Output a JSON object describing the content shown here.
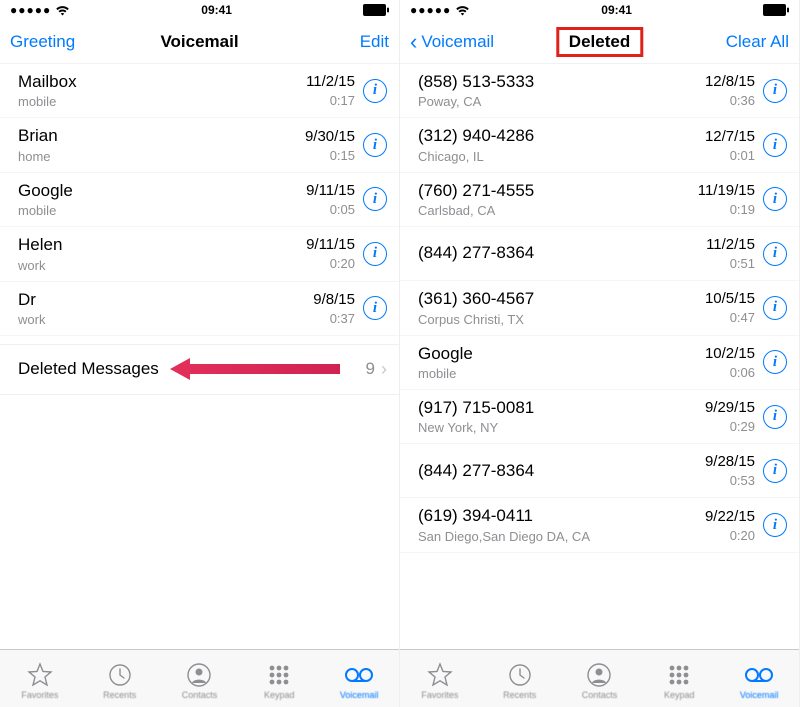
{
  "status": {
    "time": "09:41",
    "signal_dots": "●●●●●"
  },
  "left": {
    "nav": {
      "left": "Greeting",
      "title": "Voicemail",
      "right": "Edit"
    },
    "rows": [
      {
        "name": "Mailbox",
        "sub": "mobile",
        "date": "11/2/15",
        "dur": "0:17"
      },
      {
        "name": "Brian",
        "sub": "home",
        "date": "9/30/15",
        "dur": "0:15"
      },
      {
        "name": "Google",
        "sub": "mobile",
        "date": "9/11/15",
        "dur": "0:05"
      },
      {
        "name": "Helen",
        "sub": "work",
        "date": "9/11/15",
        "dur": "0:20"
      },
      {
        "name": "Dr",
        "sub": "work",
        "date": "9/8/15",
        "dur": "0:37"
      }
    ],
    "deleted": {
      "label": "Deleted Messages",
      "count": "9"
    }
  },
  "right": {
    "nav": {
      "back": "Voicemail",
      "title": "Deleted",
      "right": "Clear All"
    },
    "rows": [
      {
        "name": "(858) 513-5333",
        "sub": "Poway, CA",
        "date": "12/8/15",
        "dur": "0:36"
      },
      {
        "name": "(312) 940-4286",
        "sub": "Chicago, IL",
        "date": "12/7/15",
        "dur": "0:01"
      },
      {
        "name": "(760) 271-4555",
        "sub": "Carlsbad, CA",
        "date": "11/19/15",
        "dur": "0:19"
      },
      {
        "name": "(844) 277-8364",
        "sub": "",
        "date": "11/2/15",
        "dur": "0:51"
      },
      {
        "name": "(361) 360-4567",
        "sub": "Corpus Christi, TX",
        "date": "10/5/15",
        "dur": "0:47"
      },
      {
        "name": "Google",
        "sub": "mobile",
        "date": "10/2/15",
        "dur": "0:06"
      },
      {
        "name": "(917) 715-0081",
        "sub": "New York, NY",
        "date": "9/29/15",
        "dur": "0:29"
      },
      {
        "name": "(844) 277-8364",
        "sub": "",
        "date": "9/28/15",
        "dur": "0:53"
      },
      {
        "name": "(619) 394-0411",
        "sub": "San Diego,San Diego DA, CA",
        "date": "9/22/15",
        "dur": "0:20"
      }
    ]
  },
  "tabs": [
    {
      "label": "Favorites"
    },
    {
      "label": "Recents"
    },
    {
      "label": "Contacts"
    },
    {
      "label": "Keypad"
    },
    {
      "label": "Voicemail"
    }
  ],
  "info_glyph": "i"
}
